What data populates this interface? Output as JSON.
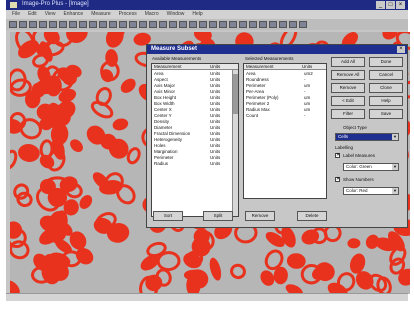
{
  "window": {
    "title": "Image-Pro Plus - [Image]",
    "controls": [
      "_",
      "□",
      "×"
    ]
  },
  "menubar": [
    "File",
    "Edit",
    "View",
    "Enhance",
    "Measure",
    "Process",
    "Macro",
    "Window",
    "Help"
  ],
  "dialog": {
    "title": "Measure Subset",
    "available_label": "Available Measurements",
    "selected_label": "Selected Measurements",
    "available_headers": [
      "Measurement",
      "Units"
    ],
    "selected_headers": [
      "Measurement",
      "Units"
    ],
    "available_rows": [
      {
        "name": "Area",
        "unit": "Units"
      },
      {
        "name": "Aspect",
        "unit": "Units"
      },
      {
        "name": "Axis Major",
        "unit": "Units"
      },
      {
        "name": "Axis Minor",
        "unit": "Units"
      },
      {
        "name": "Box Height",
        "unit": "Units"
      },
      {
        "name": "Box Width",
        "unit": "Units"
      },
      {
        "name": "Center X",
        "unit": "Units"
      },
      {
        "name": "Center Y",
        "unit": "Units"
      },
      {
        "name": "Density",
        "unit": "Units"
      },
      {
        "name": "Diameter",
        "unit": "Units"
      },
      {
        "name": "Fractal Dimension",
        "unit": "Units"
      },
      {
        "name": "Heterogeneity",
        "unit": "Units"
      },
      {
        "name": "Holes",
        "unit": "Units"
      },
      {
        "name": "Margination",
        "unit": "Units"
      },
      {
        "name": "Perimeter",
        "unit": "Units"
      },
      {
        "name": "Radius",
        "unit": "Units"
      }
    ],
    "selected_rows": [
      {
        "name": "Area",
        "unit": "um2"
      },
      {
        "name": "Roundness",
        "unit": "-"
      },
      {
        "name": "Perimeter",
        "unit": "um"
      },
      {
        "name": "Per-Area",
        "unit": "-"
      },
      {
        "name": "Perimeter (Poly)",
        "unit": "um"
      },
      {
        "name": "Perimeter 2",
        "unit": "um"
      },
      {
        "name": "Radius Max",
        "unit": "um"
      },
      {
        "name": "Count",
        "unit": "-"
      }
    ],
    "bottom_buttons": [
      "Sort",
      "Split",
      "Remove",
      "Delete"
    ],
    "right_buttons": [
      [
        "Add All",
        "Done"
      ],
      [
        "Remove All",
        "Cancel"
      ],
      [
        "Remove",
        "Clone"
      ],
      [
        "< Edit",
        "Help"
      ],
      [
        "Filter",
        "Save"
      ]
    ],
    "object_label": "Object Type",
    "object_value": "Cells",
    "labels_label": "Labelling",
    "check1_label": "Label Measures",
    "combo1_value": "Color: Green",
    "check2_label": "Show Numbers",
    "combo2_value": "Color: Red"
  },
  "statusbar": {
    "text": ""
  },
  "colors": {
    "cells": "#e8321e",
    "background": "#b6b6b6",
    "title": "#1f2f90"
  }
}
